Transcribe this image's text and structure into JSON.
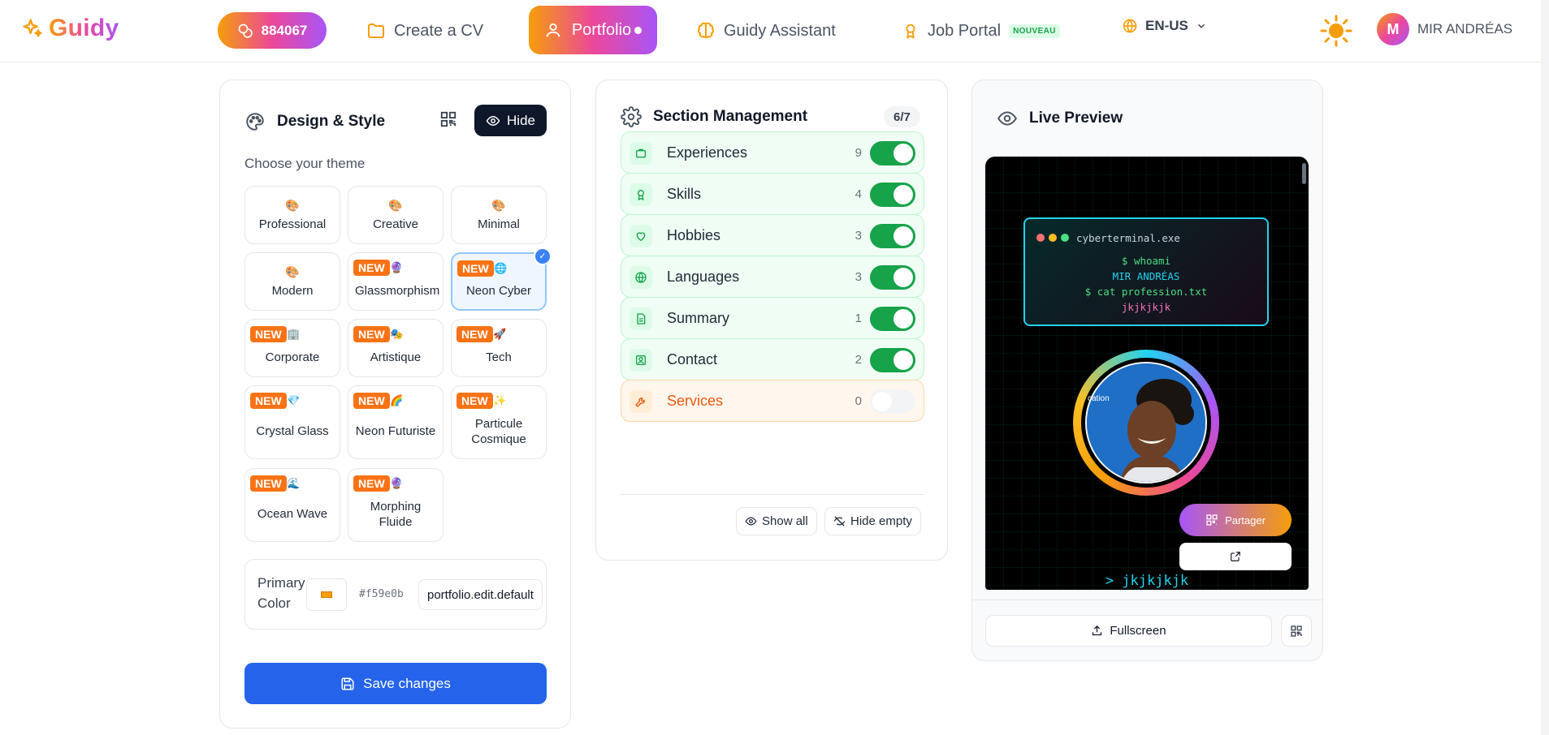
{
  "header": {
    "logo_text": "Guidy",
    "points": "884067",
    "nav": {
      "create_cv": "Create a CV",
      "portfolio": "Portfolio",
      "assistant": "Guidy Assistant",
      "job_portal": "Job Portal",
      "job_portal_badge": "NOUVEAU"
    },
    "language": "EN-US",
    "user_initial": "M",
    "user_name": "MIR ANDRÉAS"
  },
  "design": {
    "title": "Design & Style",
    "hide_label": "Hide",
    "choose_theme": "Choose your theme",
    "new_label": "NEW",
    "themes": [
      {
        "name": "Professional",
        "emoji": "🎨",
        "new": false
      },
      {
        "name": "Creative",
        "emoji": "🎨",
        "new": false
      },
      {
        "name": "Minimal",
        "emoji": "🎨",
        "new": false
      },
      {
        "name": "Modern",
        "emoji": "🎨",
        "new": false
      },
      {
        "name": "Glassmorphism",
        "emoji": "🔮",
        "new": true
      },
      {
        "name": "Neon Cyber",
        "emoji": "🌐",
        "new": true,
        "selected": true
      },
      {
        "name": "Corporate",
        "emoji": "🏢",
        "new": true
      },
      {
        "name": "Artistique",
        "emoji": "🎭",
        "new": true
      },
      {
        "name": "Tech",
        "emoji": "🚀",
        "new": true
      },
      {
        "name": "Crystal Glass",
        "emoji": "💎",
        "new": true
      },
      {
        "name": "Neon Futuriste",
        "emoji": "🌈",
        "new": true
      },
      {
        "name": "Particule Cosmique",
        "emoji": "✨",
        "new": true
      },
      {
        "name": "Ocean Wave",
        "emoji": "🌊",
        "new": true
      },
      {
        "name": "Morphing Fluide",
        "emoji": "🔮",
        "new": true
      }
    ],
    "primary_color_label": "Primary Color",
    "primary_color_hex": "#f59e0b",
    "primary_color_default": "portfolio.edit.default",
    "save_label": "Save changes"
  },
  "sections": {
    "title": "Section Management",
    "count": "6/7",
    "items": [
      {
        "label": "Experiences",
        "count": "9",
        "enabled": true
      },
      {
        "label": "Skills",
        "count": "4",
        "enabled": true
      },
      {
        "label": "Hobbies",
        "count": "3",
        "enabled": true
      },
      {
        "label": "Languages",
        "count": "3",
        "enabled": true
      },
      {
        "label": "Summary",
        "count": "1",
        "enabled": true
      },
      {
        "label": "Contact",
        "count": "2",
        "enabled": true
      },
      {
        "label": "Services",
        "count": "0",
        "enabled": false
      }
    ],
    "show_all": "Show all",
    "hide_empty": "Hide empty"
  },
  "preview": {
    "title": "Live Preview",
    "terminal_title": "cyberterminal.exe",
    "terminal_lines": [
      "$ whoami",
      "MIR ANDRÉAS",
      "$ cat profession.txt",
      "jkjkjkjk"
    ],
    "ring_text": "cation",
    "share_label": "Partager",
    "tagline": "> jkjkjkjk",
    "fullscreen_label": "Fullscreen"
  },
  "colors": {
    "accent": "#f59e0b",
    "primary_button": "#2563eb",
    "toggle_on": "#16a34a",
    "terminal_cyan": "#22d3ee"
  }
}
